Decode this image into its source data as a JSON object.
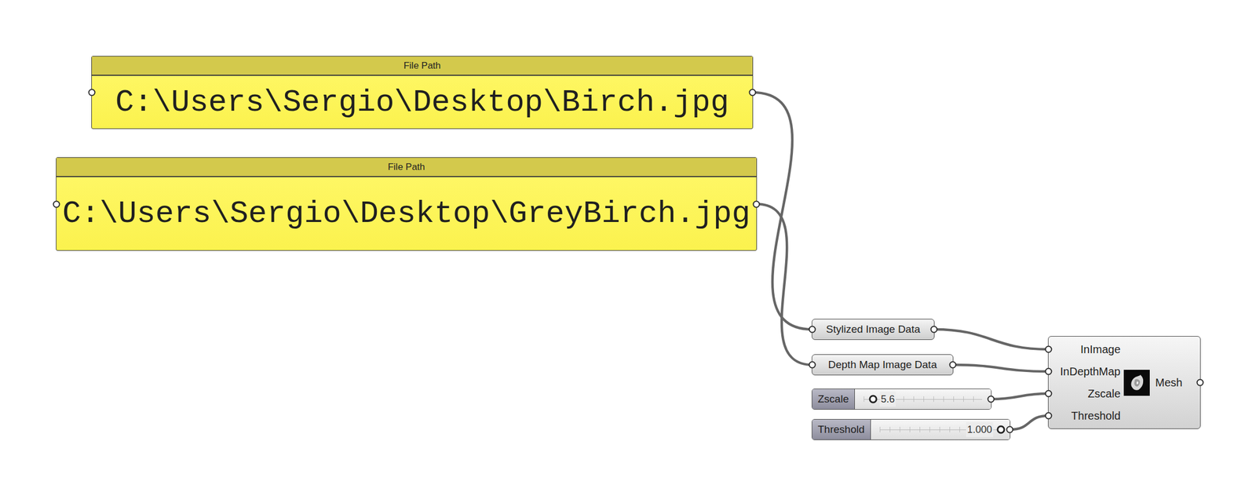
{
  "panels": [
    {
      "title": "File Path",
      "text": "C:\\Users\\Sergio\\Desktop\\Birch.jpg"
    },
    {
      "title": "File Path",
      "text": "C:\\Users\\Sergio\\Desktop\\GreyBirch.jpg"
    }
  ],
  "params": [
    {
      "label": "Stylized Image Data"
    },
    {
      "label": "Depth Map Image Data"
    }
  ],
  "sliders": [
    {
      "label": "Zscale",
      "reading": "5.6",
      "level": 0.08
    },
    {
      "label": "Threshold",
      "reading": "1.000",
      "level": 1
    }
  ],
  "component": {
    "inputs": [
      "InImage",
      "InDepthMap",
      "Zscale",
      "Threshold"
    ],
    "outputs": [
      "Mesh"
    ]
  },
  "wires": [
    {
      "from": "panels.0",
      "to": "params.0"
    },
    {
      "from": "panels.1",
      "to": "params.1"
    },
    {
      "from": "params.0",
      "to": "component.inputs.0"
    },
    {
      "from": "params.1",
      "to": "component.inputs.1"
    },
    {
      "from": "sliders.0",
      "to": "component.inputs.2"
    },
    {
      "from": "sliders.1",
      "to": "component.inputs.3"
    }
  ]
}
